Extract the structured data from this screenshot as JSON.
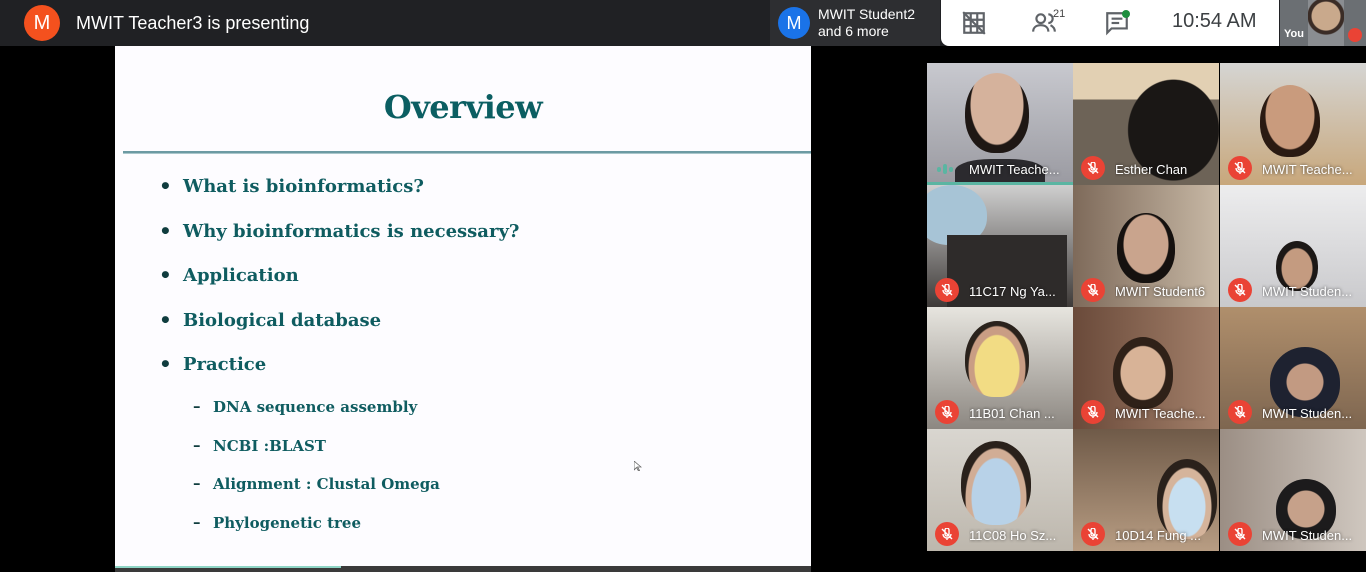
{
  "topbar": {
    "presenter_initial": "M",
    "presenter_text": "MWIT Teacher3 is presenting",
    "chip_initial": "M",
    "chip_line1": "MWIT Student2",
    "chip_line2": "and 6 more",
    "people_count": "21",
    "clock": "10:54  AM",
    "self_label": "You"
  },
  "slide": {
    "title": "Overview",
    "bullets": [
      "What is bioinformatics?",
      "Why bioinformatics is necessary?",
      "Application",
      "Biological database",
      "Practice"
    ],
    "sub_bullets": [
      "DNA sequence assembly",
      "NCBI :BLAST",
      "Alignment : Clustal Omega",
      "Phylogenetic tree"
    ]
  },
  "participants": [
    {
      "name": "MWIT Teache...",
      "speaking": true
    },
    {
      "name": "Esther Chan",
      "speaking": false
    },
    {
      "name": "MWIT Teache...",
      "speaking": false
    },
    {
      "name": "11C17 Ng Ya...",
      "speaking": false
    },
    {
      "name": "MWIT Student6",
      "speaking": false
    },
    {
      "name": "MWIT Studen...",
      "speaking": false
    },
    {
      "name": "11B01 Chan ...",
      "speaking": false
    },
    {
      "name": "MWIT Teache...",
      "speaking": false
    },
    {
      "name": "MWIT Studen...",
      "speaking": false
    },
    {
      "name": "11C08 Ho Sz...",
      "speaking": false
    },
    {
      "name": "10D14 Fung ...",
      "speaking": false
    },
    {
      "name": "MWIT Studen...",
      "speaking": false
    }
  ],
  "colors": {
    "topbar_bg": "#202124",
    "presenter_avatar": "#f4511e",
    "chip_avatar": "#1a73e8",
    "mute_red": "#ea4335",
    "speaking_teal": "#5bb5a2",
    "slide_text": "#0f5c60"
  },
  "icons": [
    "layout-grid-icon",
    "people-icon",
    "chat-icon",
    "mic-off-icon",
    "speaking-icon",
    "cursor-icon"
  ]
}
